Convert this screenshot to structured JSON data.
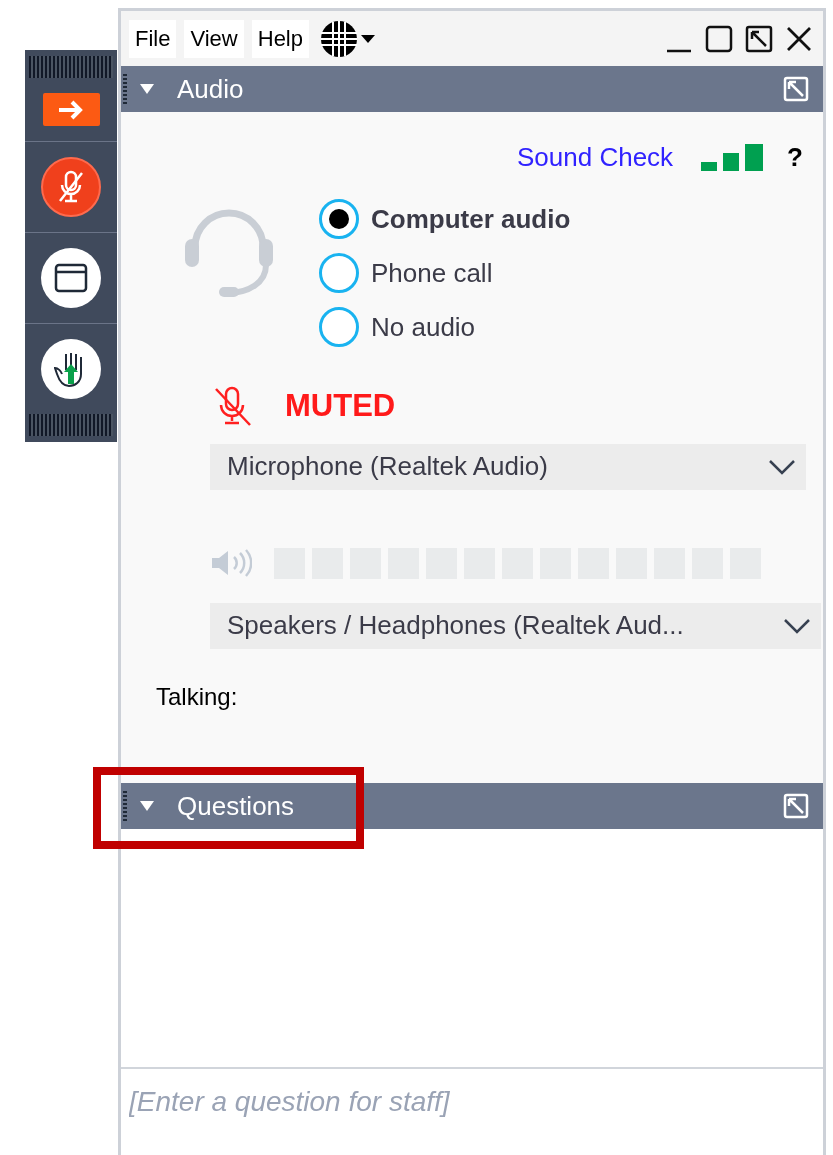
{
  "toolbar": {
    "buttons": [
      {
        "kind": "arrow"
      },
      {
        "kind": "mic"
      },
      {
        "kind": "window"
      },
      {
        "kind": "hand"
      }
    ]
  },
  "window": {
    "menu": [
      "File",
      "View",
      "Help"
    ]
  },
  "audio_panel": {
    "title": "Audio",
    "expanded": true,
    "sound_check": "Sound Check",
    "help": "?",
    "options": [
      {
        "label": "Computer audio",
        "selected": true
      },
      {
        "label": "Phone call",
        "selected": false
      },
      {
        "label": "No audio",
        "selected": false
      }
    ],
    "muted": true,
    "mute_label": "MUTED",
    "microphone": "Microphone (Realtek Audio)",
    "speaker_meter": {
      "level": 0
    },
    "speakers": "Speakers / Headphones (Realtek Aud...",
    "talking": "Talking:"
  },
  "questions_panel": {
    "title": "Questions",
    "expanded": true,
    "highlighted": true,
    "placeholder": "[Enter a question for staff]"
  }
}
